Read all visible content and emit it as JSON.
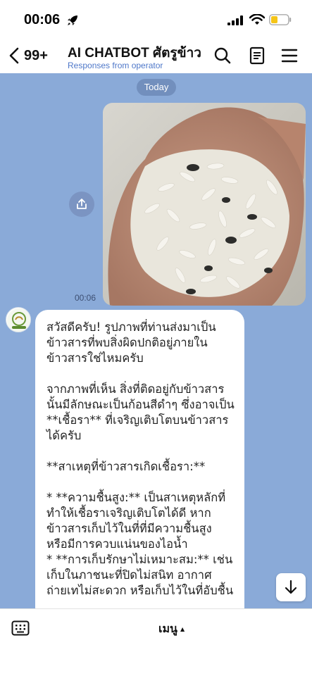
{
  "status": {
    "time": "00:06"
  },
  "header": {
    "back_count": "99+",
    "title": "AI CHATBOT ศัตรูข้าว",
    "subtitle": "Responses from operator"
  },
  "chat": {
    "date_label": "Today",
    "image_time": "00:06",
    "bot_message": "สวัสดีครับ! รูปภาพที่ท่านส่งมาเป็นข้าวสารที่พบสิ่งผิดปกติอยู่ภายในข้าวสารใช่ไหมครับ\n\nจากภาพที่เห็น สิ่งที่ติดอยู่กับข้าวสารนั้นมีลักษณะเป็นก้อนสีดำๆ ซึ่งอาจเป็น **เชื้อรา** ที่เจริญเติบโตบนข้าวสารได้ครับ\n\n**สาเหตุที่ข้าวสารเกิดเชื้อรา:**\n\n*   **ความชื้นสูง:** เป็นสาเหตุหลักที่ทำให้เชื้อราเจริญเติบโตได้ดี หากข้าวสารเก็บไว้ในที่ที่มีความชื้นสูง หรือมีการควบแน่นของไอน้ำ\n*   **การเก็บรักษาไม่เหมาะสม:** เช่น เก็บในภาชนะที่ปิดไม่สนิท อากาศถ่ายเทไม่สะดวก หรือเก็บไว้ในที่อับชื้น"
  },
  "bottom": {
    "menu_label": "เมนู",
    "menu_caret": "▲"
  },
  "colors": {
    "chat_background": "#8aaad8",
    "subtitle": "#4f78c9"
  }
}
